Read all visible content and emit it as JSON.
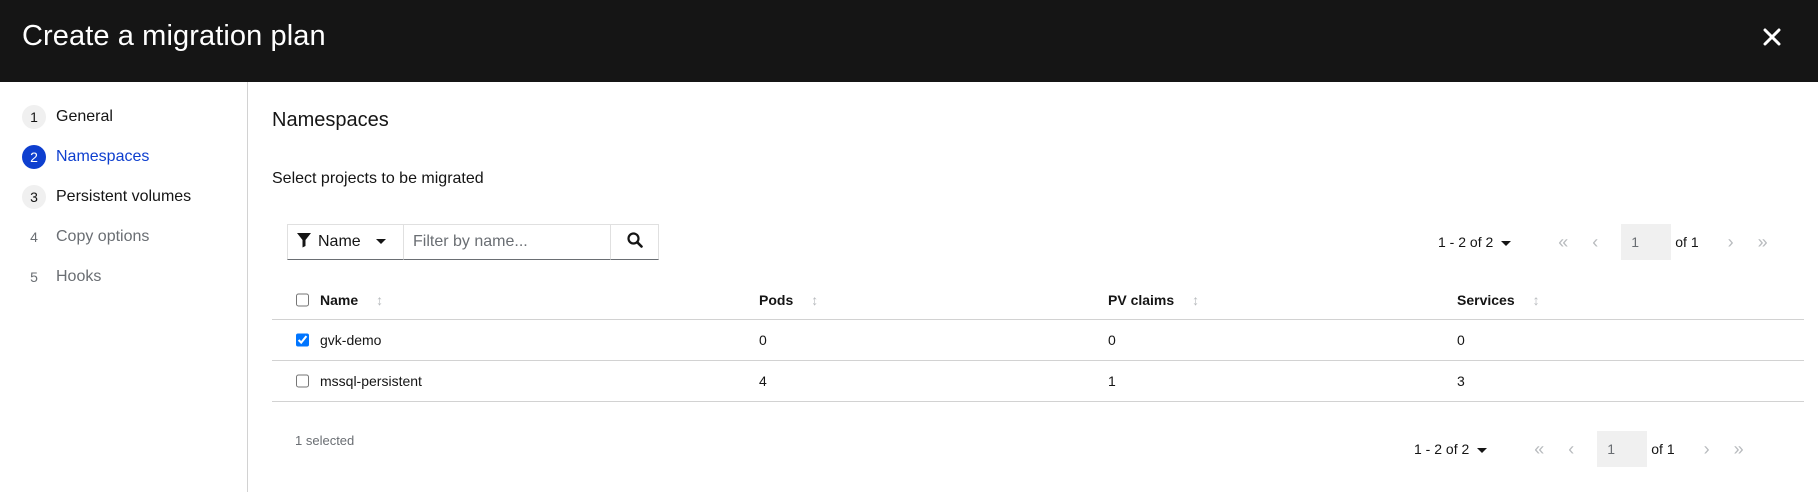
{
  "modal": {
    "title": "Create a migration plan",
    "close_icon": "close-icon"
  },
  "wizard": {
    "steps": [
      {
        "number": "1",
        "label": "General",
        "state": "visited"
      },
      {
        "number": "2",
        "label": "Namespaces",
        "state": "current"
      },
      {
        "number": "3",
        "label": "Persistent volumes",
        "state": "visited"
      },
      {
        "number": "4",
        "label": "Copy options",
        "state": "disabled"
      },
      {
        "number": "5",
        "label": "Hooks",
        "state": "disabled"
      }
    ]
  },
  "main": {
    "title": "Namespaces",
    "subtitle": "Select projects to be migrated",
    "filter": {
      "attribute": "Name",
      "placeholder": "Filter by name...",
      "value": ""
    },
    "pagination_top": {
      "range": "1 - 2 of 2",
      "page": "1",
      "of": "of 1"
    },
    "table": {
      "columns": [
        "Name",
        "Pods",
        "PV claims",
        "Services"
      ],
      "rows": [
        {
          "selected": true,
          "name": "gvk-demo",
          "pods": "0",
          "pv_claims": "0",
          "services": "0"
        },
        {
          "selected": false,
          "name": "mssql-persistent",
          "pods": "4",
          "pv_claims": "1",
          "services": "3"
        }
      ]
    },
    "selected_count": "1 selected",
    "pagination_bottom": {
      "range": "1 - 2 of 2",
      "page": "1",
      "of": "of 1"
    }
  },
  "colors": {
    "header_bg": "#151515",
    "accent": "#0e3fcf",
    "muted": "#6a6e73",
    "border": "#d2d2d2"
  }
}
